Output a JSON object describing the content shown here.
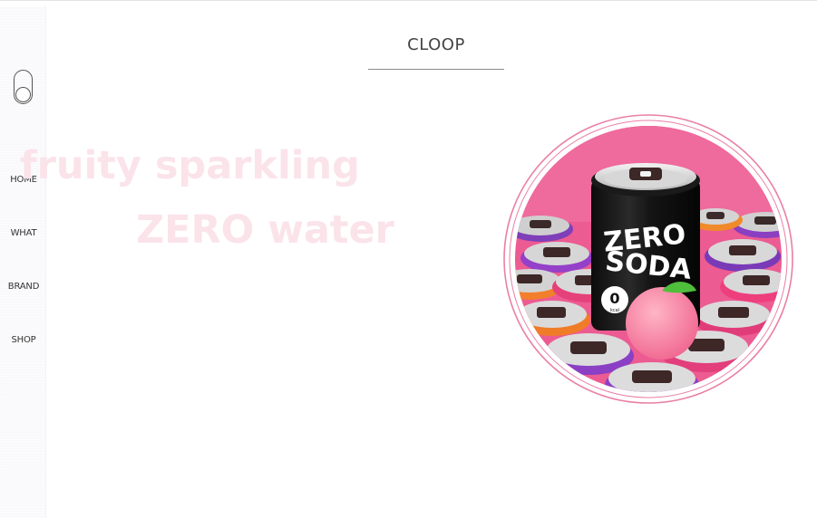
{
  "brand": {
    "logo": "CLOOP"
  },
  "nav": {
    "items": [
      {
        "label": "HOME"
      },
      {
        "label": "WHAT"
      },
      {
        "label": "BRAND"
      },
      {
        "label": "SHOP"
      }
    ]
  },
  "hero": {
    "line1": "fruity sparkling",
    "line2": "ZERO water"
  },
  "product": {
    "can_line1": "ZERO",
    "can_line2": "SODA",
    "kcal_value": "0",
    "kcal_unit": "kcal"
  },
  "colors": {
    "accent_pink": "#e85f98",
    "hero_text": "#fbe3ea",
    "background_pink": "#ec5b92"
  },
  "icons": {
    "toggle": "toggle-switch-icon"
  }
}
